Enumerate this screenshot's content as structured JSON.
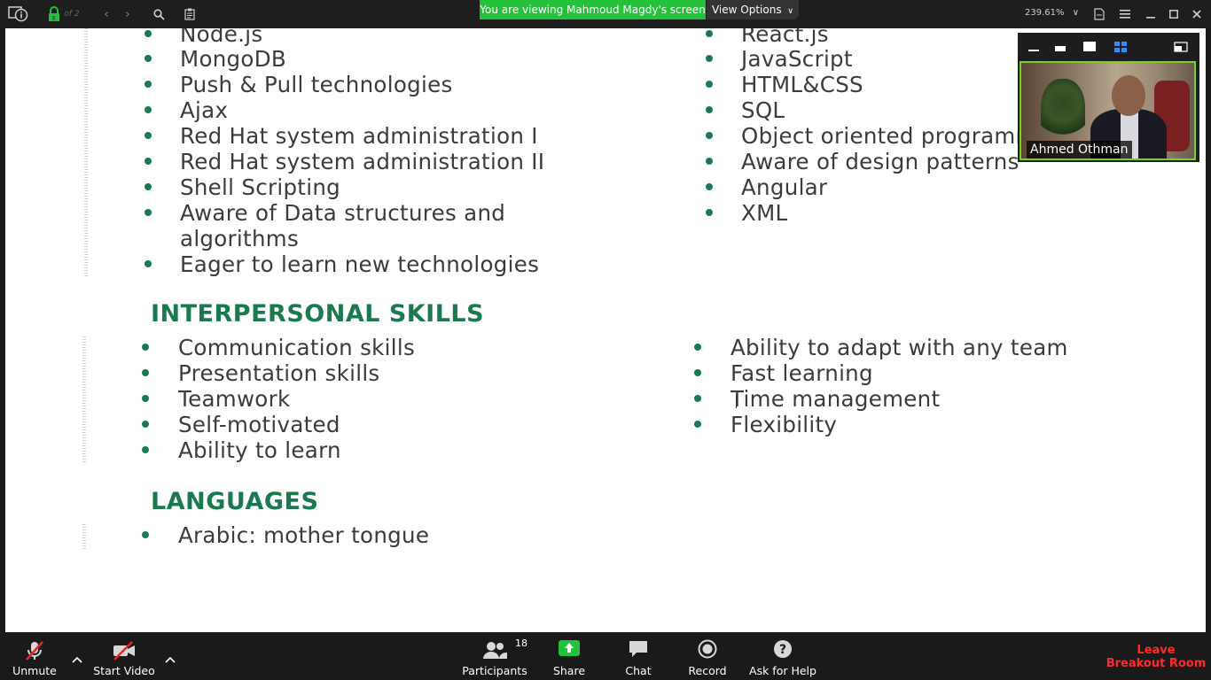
{
  "toolbar_top": {
    "page_indicator": "of 2",
    "zoom_level": "239.61%",
    "banner_text": "You are viewing Mahmoud Magdy's screen",
    "view_options_label": "View Options"
  },
  "document": {
    "technical_left": [
      "Node.js",
      "MongoDB",
      "Push & Pull technologies",
      "Ajax",
      "Red Hat system administration I",
      "Red Hat system administration II",
      "Shell Scripting",
      "Aware of Data structures and",
      "algorithms",
      "Eager to learn new technologies"
    ],
    "technical_right": [
      "React.js",
      "JavaScript",
      "HTML&CSS",
      "SQL",
      "Object oriented programming",
      "Aware of design patterns",
      "Angular",
      "XML"
    ],
    "interpersonal_heading": "INTERPERSONAL SKILLS",
    "interpersonal_left": [
      "Communication skills",
      "Presentation skills",
      "Teamwork",
      "Self-motivated",
      "Ability to learn"
    ],
    "interpersonal_right": [
      "Ability to adapt with any team",
      "Fast learning",
      "Time management",
      "Flexibility"
    ],
    "languages_heading": "LANGUAGES",
    "languages": [
      "Arabic: mother tongue"
    ]
  },
  "video": {
    "participant_name": "Ahmed Othman"
  },
  "toolbar_bottom": {
    "unmute": "Unmute",
    "start_video": "Start Video",
    "participants": "Participants",
    "participants_count": "18",
    "share": "Share",
    "chat": "Chat",
    "record": "Record",
    "help": "Ask for Help",
    "leave_line1": "Leave",
    "leave_line2": "Breakout Room"
  },
  "colors": {
    "accent_green": "#1a7a4e",
    "banner_green": "#23c23a",
    "leave_red": "#ff2a2a"
  }
}
